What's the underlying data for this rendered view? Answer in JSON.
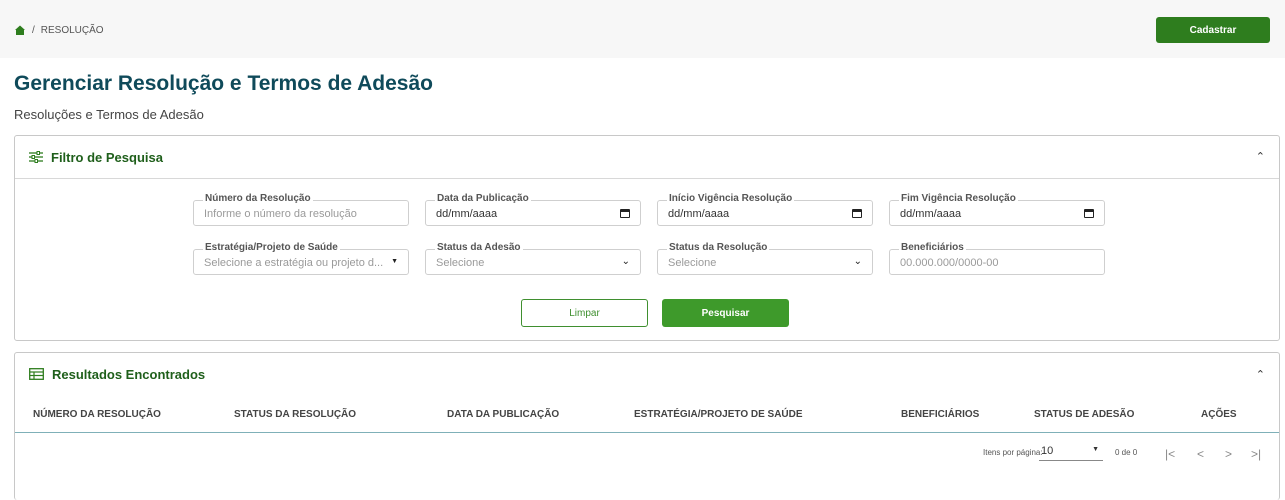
{
  "breadcrumb": {
    "current": "RESOLUÇÃO",
    "separator": "/"
  },
  "header": {
    "cadastrar_label": "Cadastrar"
  },
  "page": {
    "title": "Gerenciar Resolução e Termos de Adesão",
    "subtitle": "Resoluções e Termos de Adesão"
  },
  "filter": {
    "title": "Filtro de Pesquisa",
    "fields": [
      {
        "label": "Número da Resolução",
        "value": "Informe o número da resolução"
      },
      {
        "label": "Data da Publicação",
        "value": "dd/mm/aaaa"
      },
      {
        "label": "Início Vigência Resolução",
        "value": "dd/mm/aaaa"
      },
      {
        "label": "Fim Vigência Resolução",
        "value": "dd/mm/aaaa"
      },
      {
        "label": "Estratégia/Projeto de Saúde",
        "value": "Selecione a estratégia ou projeto d..."
      },
      {
        "label": "Status da Adesão",
        "value": "Selecione"
      },
      {
        "label": "Status da Resolução",
        "value": "Selecione"
      },
      {
        "label": "Beneficiários",
        "value": "00.000.000/0000-00"
      }
    ],
    "limpar_label": "Limpar",
    "pesquisar_label": "Pesquisar"
  },
  "results": {
    "title": "Resultados Encontrados",
    "columns": [
      "NÚMERO DA RESOLUÇÃO",
      "STATUS DA RESOLUÇÃO",
      "DATA DA PUBLICAÇÃO",
      "ESTRATÉGIA/PROJETO DE SAÚDE",
      "BENEFICIÁRIOS",
      "STATUS DE ADESÃO",
      "AÇÕES"
    ],
    "paginator": {
      "items_per_page_label": "Itens por página:",
      "page_size": "10",
      "range": "0 de 0"
    }
  },
  "colors": {
    "primary_green": "#2e7d1e",
    "title_teal": "#0f4a5a"
  },
  "icons": [
    "home-icon",
    "filter-sliders-icon",
    "table-icon",
    "chevron-up-icon",
    "calendar-icon",
    "caret-down-icon",
    "chevron-down-icon",
    "first-page-icon",
    "prev-page-icon",
    "next-page-icon",
    "last-page-icon"
  ]
}
